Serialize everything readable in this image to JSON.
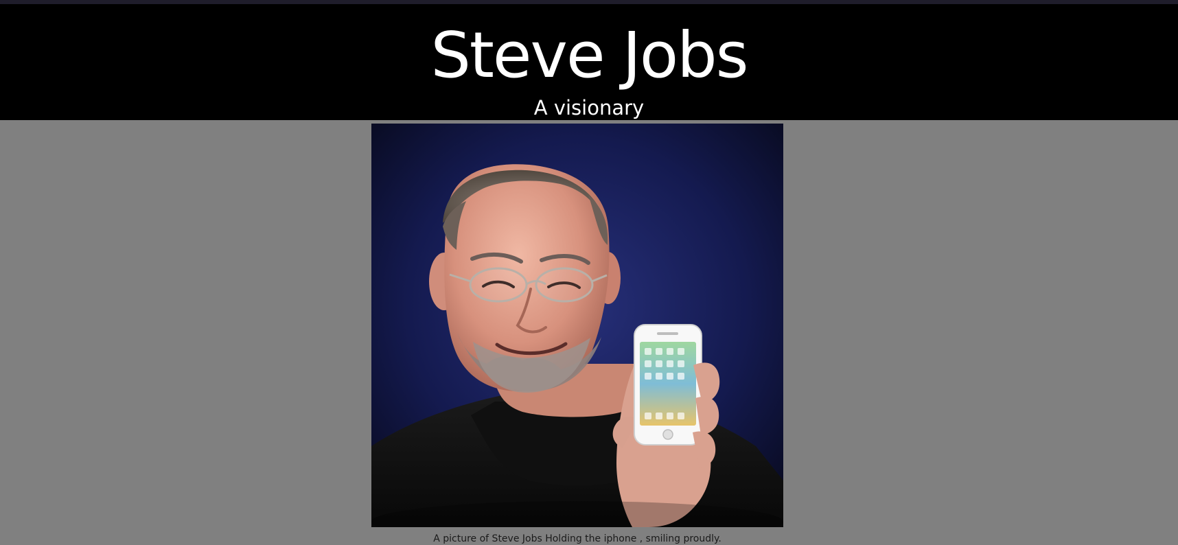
{
  "header": {
    "title": "Steve Jobs",
    "subtitle": "A visionary"
  },
  "figure": {
    "image_icon": "portrait-photo",
    "caption": "A picture of Steve Jobs Holding the iphone , smiling proudly."
  },
  "colors": {
    "header_bg": "#000000",
    "page_bg": "#808080",
    "header_text": "#ffffff",
    "caption_text": "#1a1a1a"
  }
}
